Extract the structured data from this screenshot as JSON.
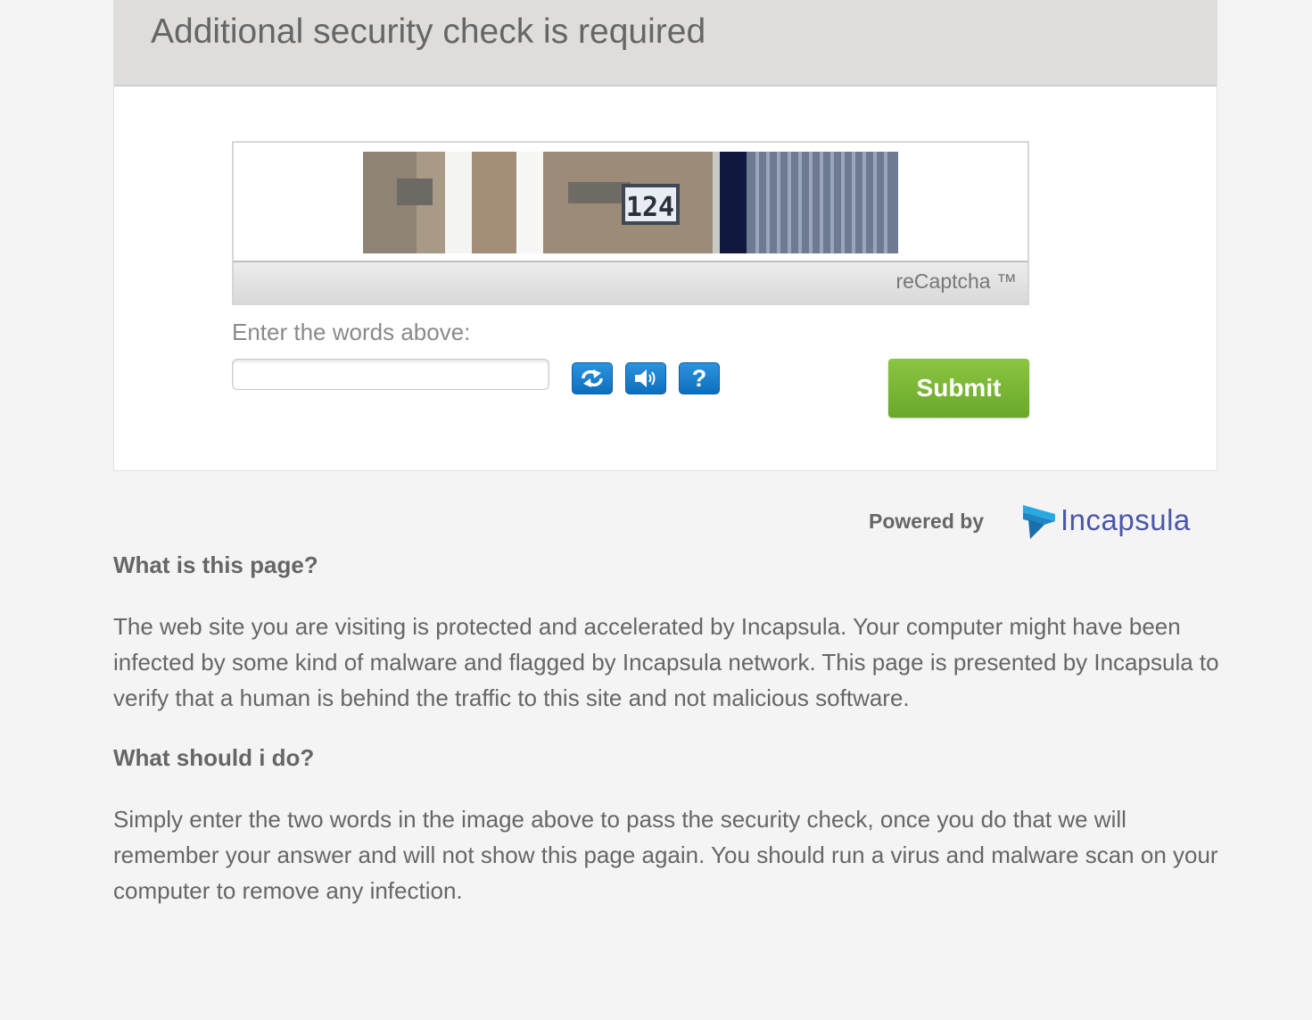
{
  "header": {
    "title": "Additional security check is required"
  },
  "captcha": {
    "image_text": "124",
    "brand_label": "reCaptcha ™",
    "enter_label": "Enter the words above:",
    "input_value": "",
    "input_placeholder": "",
    "refresh_icon": "refresh-icon",
    "audio_icon": "speaker-icon",
    "help_label": "?",
    "submit_label": "Submit"
  },
  "footer": {
    "powered_by": "Powered by",
    "logo_text": "Incapsula"
  },
  "info": {
    "q1": "What is this page?",
    "a1": "The web site you are visiting is protected and accelerated by Incapsula. Your computer might have been infected by some kind of malware and flagged by Incapsula network. This page is presented by Incapsula to verify that a human is behind the traffic to this site and not malicious software.",
    "q2": "What should i do?",
    "a2": "Simply enter the two words in the image above to pass the security check, once you do that we will remember your answer and will not show this page again. You should run a virus and malware scan on your computer to remove any infection."
  },
  "colors": {
    "submit_green": "#7ab83a",
    "icon_blue": "#1a80cc",
    "logo_blue": "#4b56a8"
  }
}
